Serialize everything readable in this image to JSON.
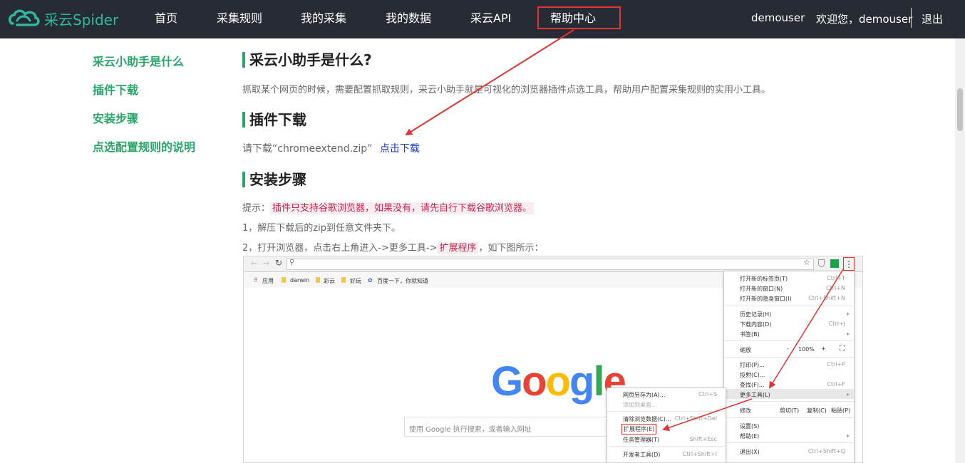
{
  "header": {
    "brand": "采云Spider",
    "nav": [
      "首页",
      "采集规则",
      "我的采集",
      "我的数据",
      "采云API",
      "帮助中心"
    ],
    "user_name": "demouser",
    "welcome": "欢迎您，demouser",
    "logout": "退出"
  },
  "sidebar": {
    "items": [
      "采云小助手是什么",
      "插件下载",
      "安装步骤",
      "点选配置规则的说明"
    ]
  },
  "main": {
    "s1_title": "采云小助手是什么?",
    "s1_text": "抓取某个网页的时候，需要配置抓取规则，采云小助手就是可视化的浏览器插件点选工具，帮助用户配置采集规则的实用小工具。",
    "s2_title": "插件下载",
    "s2_text": "请下载“chromeextend.zip”",
    "s2_link": "点击下载",
    "s3_title": "安装步骤",
    "tip_label": "提示：",
    "tip_text": "插件只支持谷歌浏览器，如果没有，请先自行下载谷歌浏览器。",
    "step1": "1，解压下载后的zip到任意文件夹下。",
    "step2_a": "2，打开浏览器，点击右上角进入->更多工具->",
    "step2_hl": "扩展程序",
    "step2_b": "，如下图所示："
  },
  "screenshot": {
    "bookmarks": [
      "应用",
      "darwin",
      "彩云",
      "好玩",
      "百度一下，你就知道"
    ],
    "google": "Google",
    "search_placeholder": "使用 Google 执行搜索，或者输入网址",
    "menu": {
      "new_tab": "打开新的标签页(T)",
      "new_tab_sc": "Ctrl+T",
      "new_window": "打开新的窗口(N)",
      "new_window_sc": "Ctrl+N",
      "incognito": "打开新的隐身窗口(I)",
      "incognito_sc": "Ctrl+Shift+N",
      "history": "历史记录(H)",
      "downloads": "下载内容(D)",
      "downloads_sc": "Ctrl+J",
      "bookmarks": "书签(B)",
      "zoom": "缩放",
      "zoom_minus": "-",
      "zoom_val": "100%",
      "zoom_plus": "+",
      "print": "打印(P)...",
      "print_sc": "Ctrl+P",
      "cast": "投射(C)...",
      "find": "查找(F)...",
      "find_sc": "Ctrl+F",
      "more_tools": "更多工具(L)",
      "edit": "修改",
      "cut": "剪切(T)",
      "copy": "复制(C)",
      "paste": "粘贴(P)",
      "settings": "设置(S)",
      "help": "帮助(E)",
      "exit": "退出(X)",
      "exit_sc": "Ctrl+Shift+Q"
    },
    "submenu": {
      "save_as": "网页另存为(A)...",
      "save_as_sc": "Ctrl+S",
      "add_desktop": "添加到桌面...",
      "clear": "清除浏览数据(C)...",
      "clear_sc": "Ctrl+Shift+Del",
      "extensions": "扩展程序(E)",
      "task_mgr": "任务管理器(T)",
      "task_mgr_sc": "Shift+Esc",
      "devtools": "开发者工具(D)",
      "devtools_sc": "Ctrl+Shift+I"
    }
  },
  "colors": {
    "header_bg": "#272b33",
    "accent": "#2aa66a",
    "brand": "#2eb9a0",
    "annotation": "#e03434"
  }
}
